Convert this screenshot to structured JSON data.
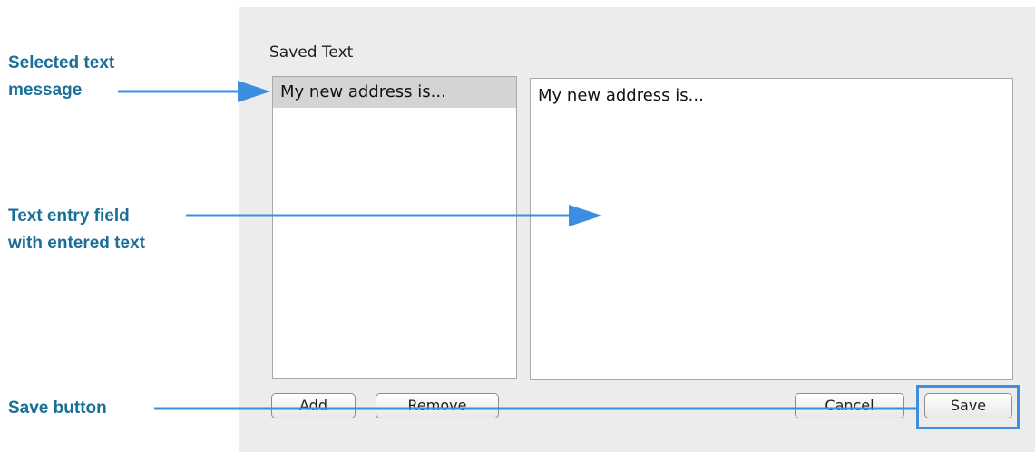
{
  "dialog": {
    "section_title": "Saved Text",
    "saved_text_list": [
      "My new address is..."
    ],
    "text_field_value": "My new address is...",
    "buttons": {
      "add": "Add",
      "remove": "Remove",
      "cancel": "Cancel",
      "save": "Save"
    }
  },
  "callouts": {
    "selected_message_line1": "Selected text",
    "selected_message_line2": "message",
    "text_entry_line1": "Text entry field",
    "text_entry_line2": "with entered text",
    "save_button": "Save button"
  },
  "colors": {
    "callout_text": "#1a6e9a",
    "arrow": "#3c8ee0",
    "dialog_bg": "#ececec",
    "selected_row": "#d4d4d4"
  }
}
